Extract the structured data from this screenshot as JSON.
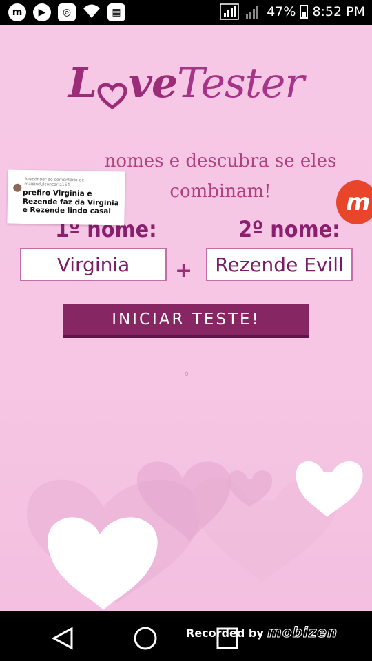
{
  "status": {
    "battery": "47%",
    "time": "8:52 PM"
  },
  "logo": {
    "love_prefix": "L",
    "love_suffix": "ve",
    "tester": "Tester"
  },
  "headline": {
    "line1": "nomes e descubra se eles",
    "line2": "combinam!"
  },
  "form": {
    "label1": "1º nome:",
    "label2": "2º nome:",
    "name1": "Virginia",
    "name2": "Rezende Evill",
    "plus": "+",
    "button": "INICIAR TESTE!"
  },
  "loading_dot": "0",
  "comment": {
    "meta": "Responder ao comentário de maisindulsoncarla154",
    "text": "prefiro Virginia e Rezende faz da Virginia e Rezende lindo casal"
  },
  "recorder": {
    "recorded_by": "Recorded by",
    "brand": "mobizen",
    "badge": "m"
  },
  "colors": {
    "accent": "#862663",
    "background": "#f7c8e6",
    "title": "#9a2c78"
  }
}
